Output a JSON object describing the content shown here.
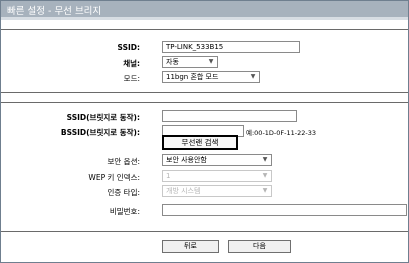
{
  "title": "빠른 설정 - 무선 브리지",
  "fields": {
    "ssid": {
      "label": "SSID:",
      "value": "TP-LINK_533B15"
    },
    "channel": {
      "label": "채널:",
      "value": "자동"
    },
    "mode": {
      "label": "모드:",
      "value": "11bgn 혼합 모드"
    },
    "bridge_ssid": {
      "label": "SSID(브릿지로 동작):",
      "value": ""
    },
    "bridge_bssid": {
      "label": "BSSID(브릿지로 동작):",
      "value": "",
      "hint": "예:00-1D-0F-11-22-33"
    },
    "survey_button": "무선랜 검색",
    "security": {
      "label": "보안 옵션:",
      "value": "보안 사용안함"
    },
    "wep_index": {
      "label": "WEP 키 인덱스:",
      "value": "1"
    },
    "auth_type": {
      "label": "인증 타입:",
      "value": "개방 시스템"
    },
    "password": {
      "label": "비밀번호:",
      "value": ""
    }
  },
  "buttons": {
    "back": "뒤로",
    "next": "다음"
  }
}
